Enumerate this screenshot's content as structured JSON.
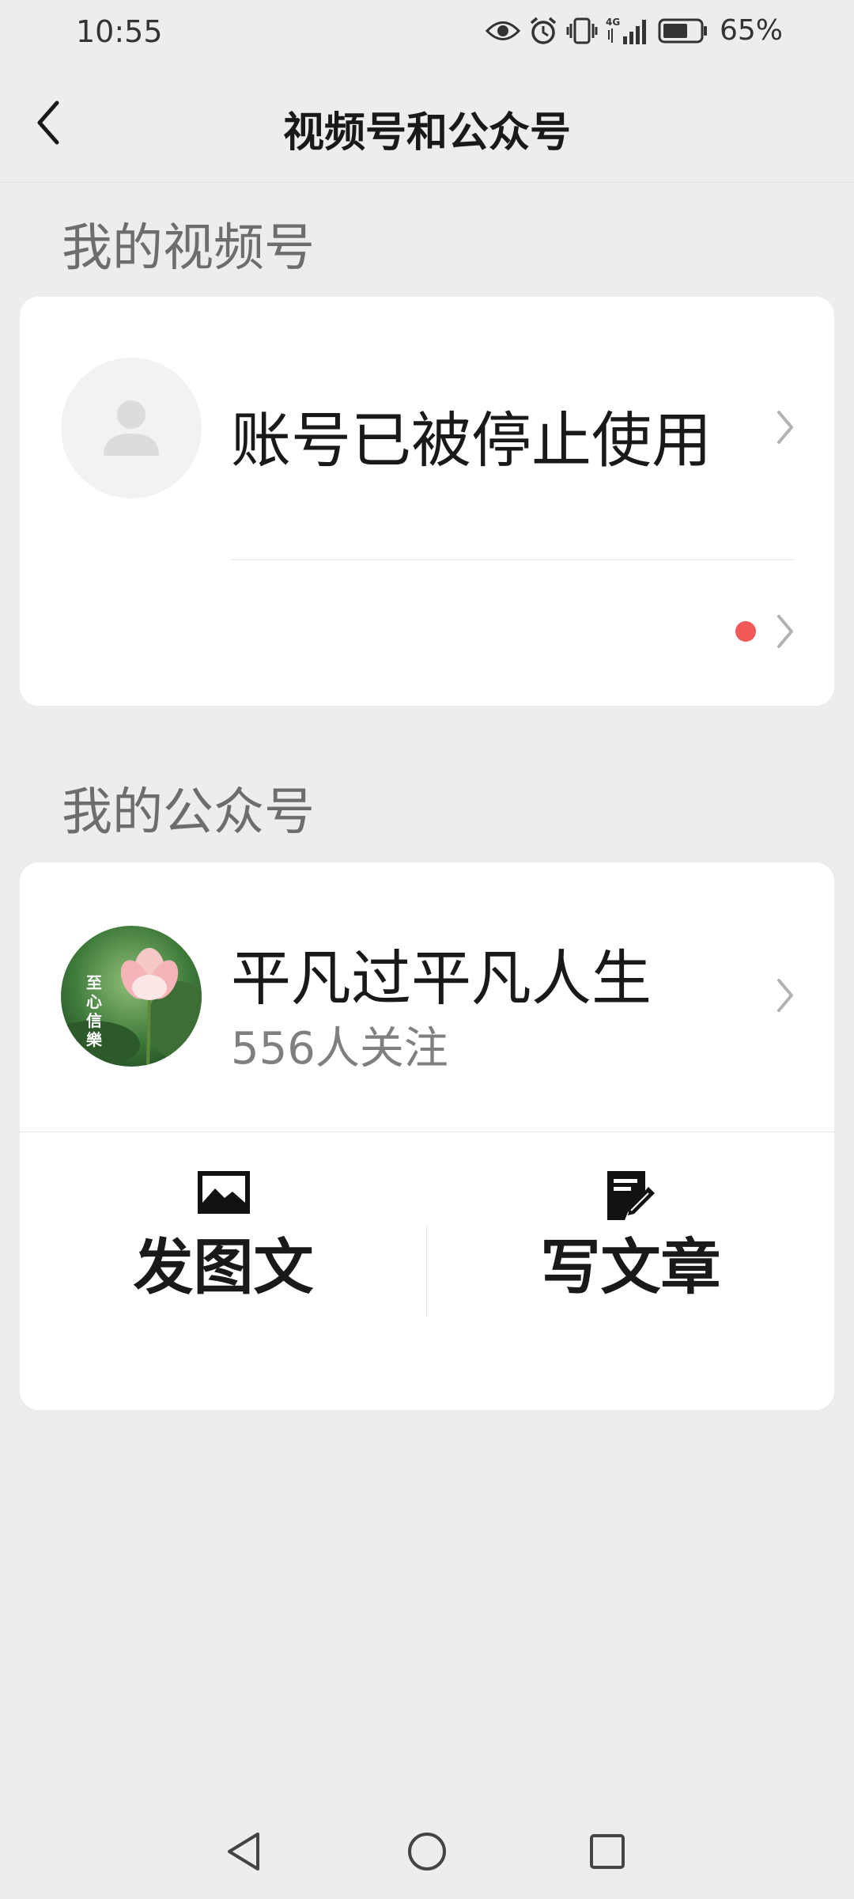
{
  "status_bar": {
    "time": "10:55",
    "battery": "65%",
    "network_label": "4G",
    "icons": [
      "eye-icon",
      "alarm-icon",
      "vibrate-icon",
      "signal-icon",
      "battery-icon"
    ]
  },
  "nav": {
    "title": "视频号和公众号",
    "back_icon": "chevron-left-icon"
  },
  "channels_section": {
    "title": "我的视频号",
    "account_name": "账号已被停止使用",
    "has_notification_dot": true,
    "notification_color": "#f25a5a"
  },
  "official_section": {
    "title": "我的公众号",
    "account_name": "平凡过平凡人生",
    "followers": "556人关注",
    "avatar_text": "至心信樂",
    "actions": [
      {
        "label": "发图文",
        "icon": "image-icon"
      },
      {
        "label": "写文章",
        "icon": "edit-document-icon"
      }
    ]
  },
  "system_nav": [
    "back-triangle-icon",
    "home-circle-icon",
    "recents-square-icon"
  ],
  "colors": {
    "background": "#ededed",
    "card": "#ffffff",
    "text_primary": "#191919",
    "text_secondary": "#7f7f7f"
  }
}
